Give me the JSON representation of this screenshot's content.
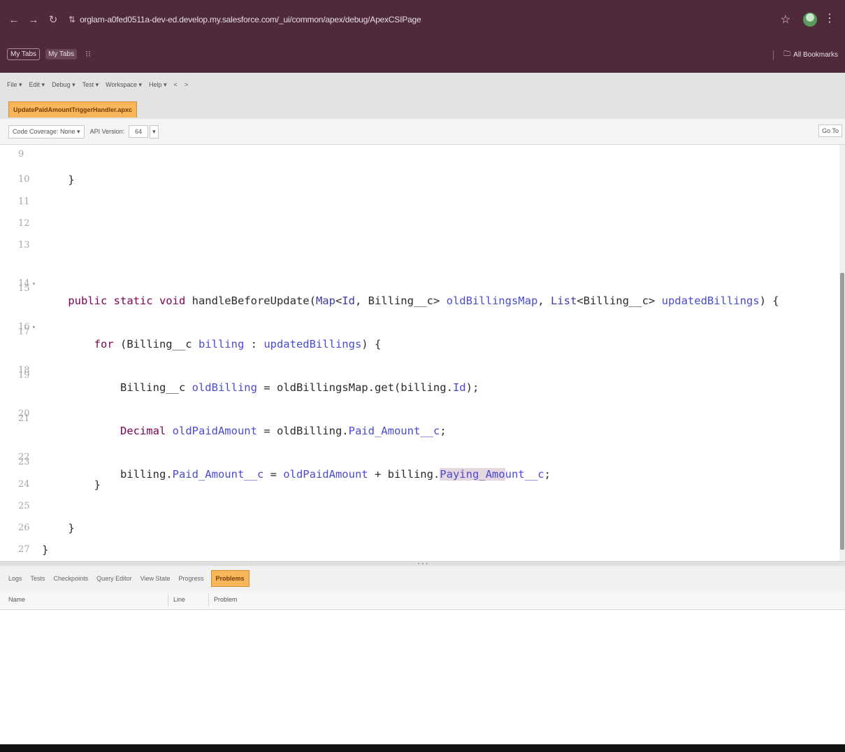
{
  "browser": {
    "url": "orglam-a0fed0511a-dev-ed.develop.my.salesforce.com/_ui/common/apex/debug/ApexCSIPage",
    "bookmarks": [
      "My Tabs",
      "My Tabs"
    ],
    "all_bookmarks": "All Bookmarks"
  },
  "menu": [
    "File ▾",
    "Edit ▾",
    "Debug ▾",
    "Test ▾",
    "Workspace ▾",
    "Help ▾",
    "<",
    ">"
  ],
  "file_tab": "UpdatePaidAmountTriggerHandler.apxc",
  "toolbar": {
    "code_coverage": "Code Coverage: None ▾",
    "api_label": "API Version:",
    "api_version": "64",
    "goto": "Go To"
  },
  "code_lines": [
    {
      "n": "9",
      "code": ""
    },
    {
      "n": "10",
      "code": "    }"
    },
    {
      "n": "11",
      "code": ""
    },
    {
      "n": "12",
      "code": ""
    },
    {
      "n": "13",
      "code": ""
    },
    {
      "n": "14",
      "code": "    public static void handleBeforeUpdate(Map<Id, Billing__c> oldBillingsMap, List<Billing__c> updatedBillings) {"
    },
    {
      "n": "15",
      "code": ""
    },
    {
      "n": "16",
      "code": "        for (Billing__c billing : updatedBillings) {"
    },
    {
      "n": "17",
      "code": ""
    },
    {
      "n": "18",
      "code": "            Billing__c oldBilling = oldBillingsMap.get(billing.Id);"
    },
    {
      "n": "19",
      "code": ""
    },
    {
      "n": "20",
      "code": "            Decimal oldPaidAmount = oldBilling.Paid_Amount__c;"
    },
    {
      "n": "21",
      "code": ""
    },
    {
      "n": "22",
      "code": "            billing.Paid_Amount__c = oldPaidAmount + billing.Paying_Amount__c;"
    },
    {
      "n": "23",
      "code": ""
    },
    {
      "n": "24",
      "code": "        }"
    },
    {
      "n": "25",
      "code": ""
    },
    {
      "n": "26",
      "code": "    }"
    },
    {
      "n": "27",
      "code": "}"
    }
  ],
  "panel_tabs": [
    "Logs",
    "Tests",
    "Checkpoints",
    "Query Editor",
    "View State",
    "Progress",
    "Problems"
  ],
  "grid_headers": [
    "Name",
    "Line",
    "Problem"
  ]
}
